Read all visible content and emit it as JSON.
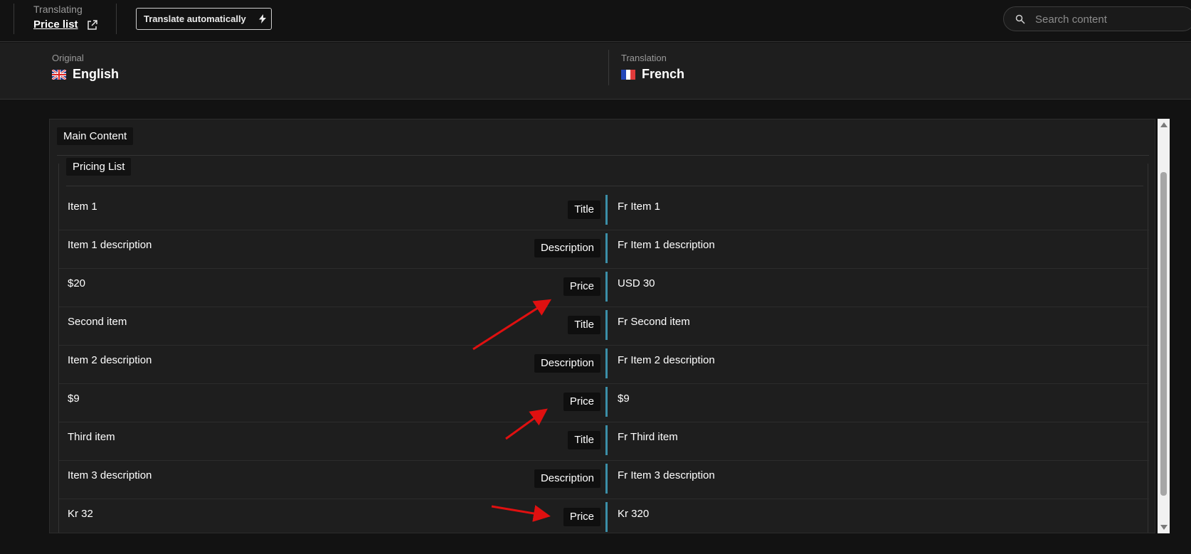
{
  "topbar": {
    "translating_label": "Translating",
    "document_title": "Price list",
    "translate_button_label": "Translate automatically",
    "search_placeholder": "Search content"
  },
  "languages": {
    "original": {
      "label": "Original",
      "name": "English",
      "flag": "uk-flag-icon"
    },
    "translation": {
      "label": "Translation",
      "name": "French",
      "flag": "france-flag-icon"
    }
  },
  "content": {
    "group_label": "Main Content",
    "subgroup_label": "Pricing List",
    "rows": [
      {
        "original": "Item 1",
        "field": "Title",
        "translation": "Fr Item 1"
      },
      {
        "original": "Item 1 description",
        "field": "Description",
        "translation": "Fr Item 1 description"
      },
      {
        "original": "$20",
        "field": "Price",
        "translation": "USD 30"
      },
      {
        "original": "Second item",
        "field": "Title",
        "translation": "Fr Second item"
      },
      {
        "original": "Item 2 description",
        "field": "Description",
        "translation": "Fr Item 2 description"
      },
      {
        "original": "$9",
        "field": "Price",
        "translation": "$9"
      },
      {
        "original": "Third item",
        "field": "Title",
        "translation": "Fr Third item"
      },
      {
        "original": "Item 3 description",
        "field": "Description",
        "translation": "Fr Item 3 description"
      },
      {
        "original": "Kr 32",
        "field": "Price",
        "translation": "Kr 320"
      }
    ]
  },
  "colors": {
    "accent_bar": "#3b8fa8",
    "annotation_arrow": "#e01010",
    "background": "#121212",
    "panel": "#1e1e1e"
  }
}
